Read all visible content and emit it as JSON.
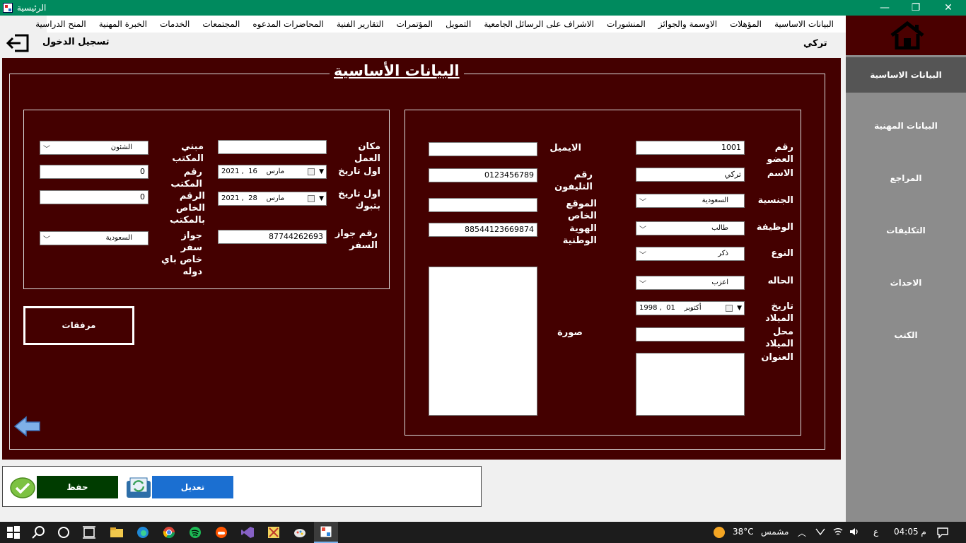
{
  "window": {
    "title": "الرئيسية",
    "controls": {
      "minimize": "—",
      "restore": "❐",
      "close": "✕"
    }
  },
  "menu": [
    "البيانات الاساسية",
    "المؤهلات",
    "الاوسمة والجوائز",
    "المنشورات",
    "الاشراف على الرسائل الجامعية",
    "التمويل",
    "المؤتمرات",
    "التقارير الفنية",
    "المحاضرات المدعوه",
    "المجتمعات",
    "الخدمات",
    "الخبرة المهنية",
    "المنح الدراسية"
  ],
  "header": {
    "login_label": "تسجيل الدخول",
    "user_name": "تركي"
  },
  "sidebar": {
    "items": [
      {
        "label": "البيانات الاساسية",
        "active": true
      },
      {
        "label": "البيانات المهنية",
        "active": false
      },
      {
        "label": "المراجع",
        "active": false
      },
      {
        "label": "التكليفات",
        "active": false
      },
      {
        "label": "الاحداث",
        "active": false
      },
      {
        "label": "الكتب",
        "active": false
      }
    ]
  },
  "section_title": "البيانات الأساسية",
  "personal": {
    "member_no": {
      "label": "رقم العضو",
      "value": "1001"
    },
    "name": {
      "label": "الاسم",
      "value": "تركي"
    },
    "nationality": {
      "label": "الجنسية",
      "value": "السعودية"
    },
    "job": {
      "label": "الوظيفة",
      "value": "طالب"
    },
    "gender": {
      "label": "النوع",
      "value": "ذكر"
    },
    "status": {
      "label": "الحاله",
      "value": "اعزب"
    },
    "birth_date": {
      "label": "تاريخ الميلاد",
      "day": "01",
      "month": "أكتوبر",
      "year": "1998"
    },
    "birth_place": {
      "label": "محل الميلاد",
      "value": ""
    },
    "address": {
      "label": "العنوان",
      "value": ""
    },
    "email": {
      "label": "الايميل",
      "value": ""
    },
    "phone": {
      "label": "رقم التليفون",
      "value": "0123456789"
    },
    "website": {
      "label": "الموقع الخاص",
      "value": ""
    },
    "national_id": {
      "label": "الهوية الوطنية",
      "value": "88544123669874"
    },
    "photo": {
      "label": "صورة"
    }
  },
  "work": {
    "workplace": {
      "label": "مكان العمل",
      "value": ""
    },
    "first_date": {
      "label": "اول تاريخ",
      "day": "16",
      "month": "مارس",
      "year": "2021"
    },
    "first_date_tabuk": {
      "label_line1": "اول تاريخ",
      "label_line2": "بتبوك",
      "day": "28",
      "month": "مارس",
      "year": "2021"
    },
    "passport_no": {
      "label_line1": "رقم جواز",
      "label_line2": "السفر",
      "value": "87744262693"
    },
    "office_building": {
      "label": "مبني المكتب",
      "value": "الشئون"
    },
    "office_no": {
      "label": "رقم المكتب",
      "value": "0"
    },
    "office_private_no": {
      "label_line1": "الرقم الخاص",
      "label_line2": "بالمكتب",
      "value": "0"
    },
    "passport_country": {
      "label_line1": "جواز سفر",
      "label_line2": "خاص باي",
      "label_line3": "دوله",
      "value": "السعودية"
    },
    "attachments_button": "مرفقات"
  },
  "actions": {
    "save": "حفظ",
    "edit": "تعديل"
  },
  "taskbar": {
    "temperature": "38°C",
    "weather": "مشمس",
    "lang": "ع",
    "time": "04:05 م"
  },
  "colors": {
    "titlebar": "#008a5e",
    "panel": "#440000",
    "sidebar": "#8c8c8c",
    "save": "#003c00",
    "edit": "#1b6fd1"
  }
}
